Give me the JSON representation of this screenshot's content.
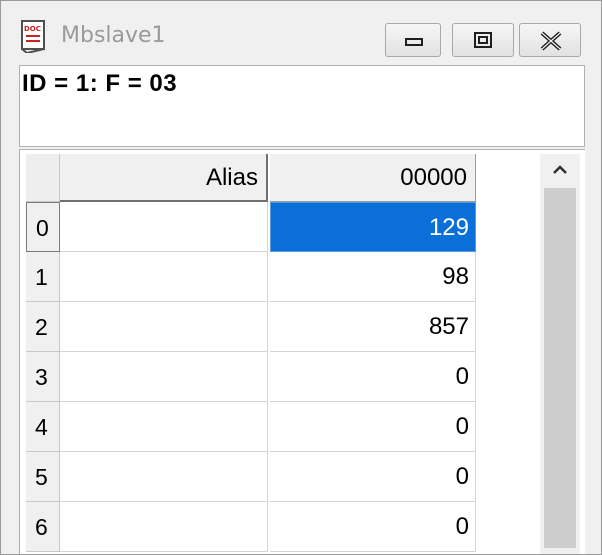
{
  "window": {
    "title": "Mbslave1",
    "icon": "document-app-icon"
  },
  "header": {
    "text": "ID = 1: F = 03"
  },
  "grid": {
    "columns": [
      "Alias",
      "00000"
    ],
    "rows": [
      {
        "index": "0",
        "alias": "",
        "value": "129",
        "selected": true
      },
      {
        "index": "1",
        "alias": "",
        "value": "98"
      },
      {
        "index": "2",
        "alias": "",
        "value": "857"
      },
      {
        "index": "3",
        "alias": "",
        "value": "0"
      },
      {
        "index": "4",
        "alias": "",
        "value": "0"
      },
      {
        "index": "5",
        "alias": "",
        "value": "0"
      },
      {
        "index": "6",
        "alias": "",
        "value": "0"
      }
    ]
  },
  "colors": {
    "selection": "#0a6fd8",
    "title_text": "#9a9a9a"
  }
}
